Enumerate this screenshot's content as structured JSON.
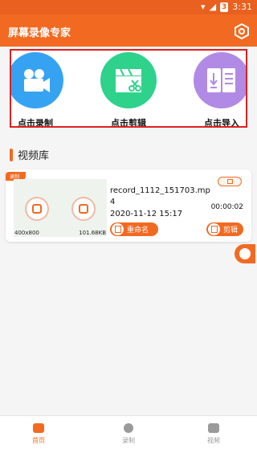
{
  "status_bar": {
    "battery": "3",
    "time": "3:31"
  },
  "app": {
    "title": "屏幕录像专家",
    "settings_icon": "hexagon-settings-icon"
  },
  "functions": [
    {
      "label": "点击录制",
      "icon": "video-camera-icon",
      "color": "#36a2f2"
    },
    {
      "label": "点击剪辑",
      "icon": "clapperboard-scissors-icon",
      "color": "#2ed28a"
    },
    {
      "label": "点击导入",
      "icon": "import-file-icon",
      "color": "#b18ae6"
    }
  ],
  "library": {
    "title": "视频库",
    "videos": [
      {
        "tag": "录制",
        "resolution": "400x800",
        "size": "101.68KB",
        "file_name": "record_1112_151703.mp4",
        "date": "2020-11-12 15:17",
        "duration": "00:00:02",
        "rename_label": "重命名",
        "edit_label": "剪辑"
      }
    ]
  },
  "bottom_nav": [
    {
      "label": "首页",
      "active": true
    },
    {
      "label": "录制",
      "active": false
    },
    {
      "label": "视频",
      "active": false
    }
  ],
  "colors": {
    "primary": "#f26a22",
    "highlight_box": "#e02020"
  }
}
